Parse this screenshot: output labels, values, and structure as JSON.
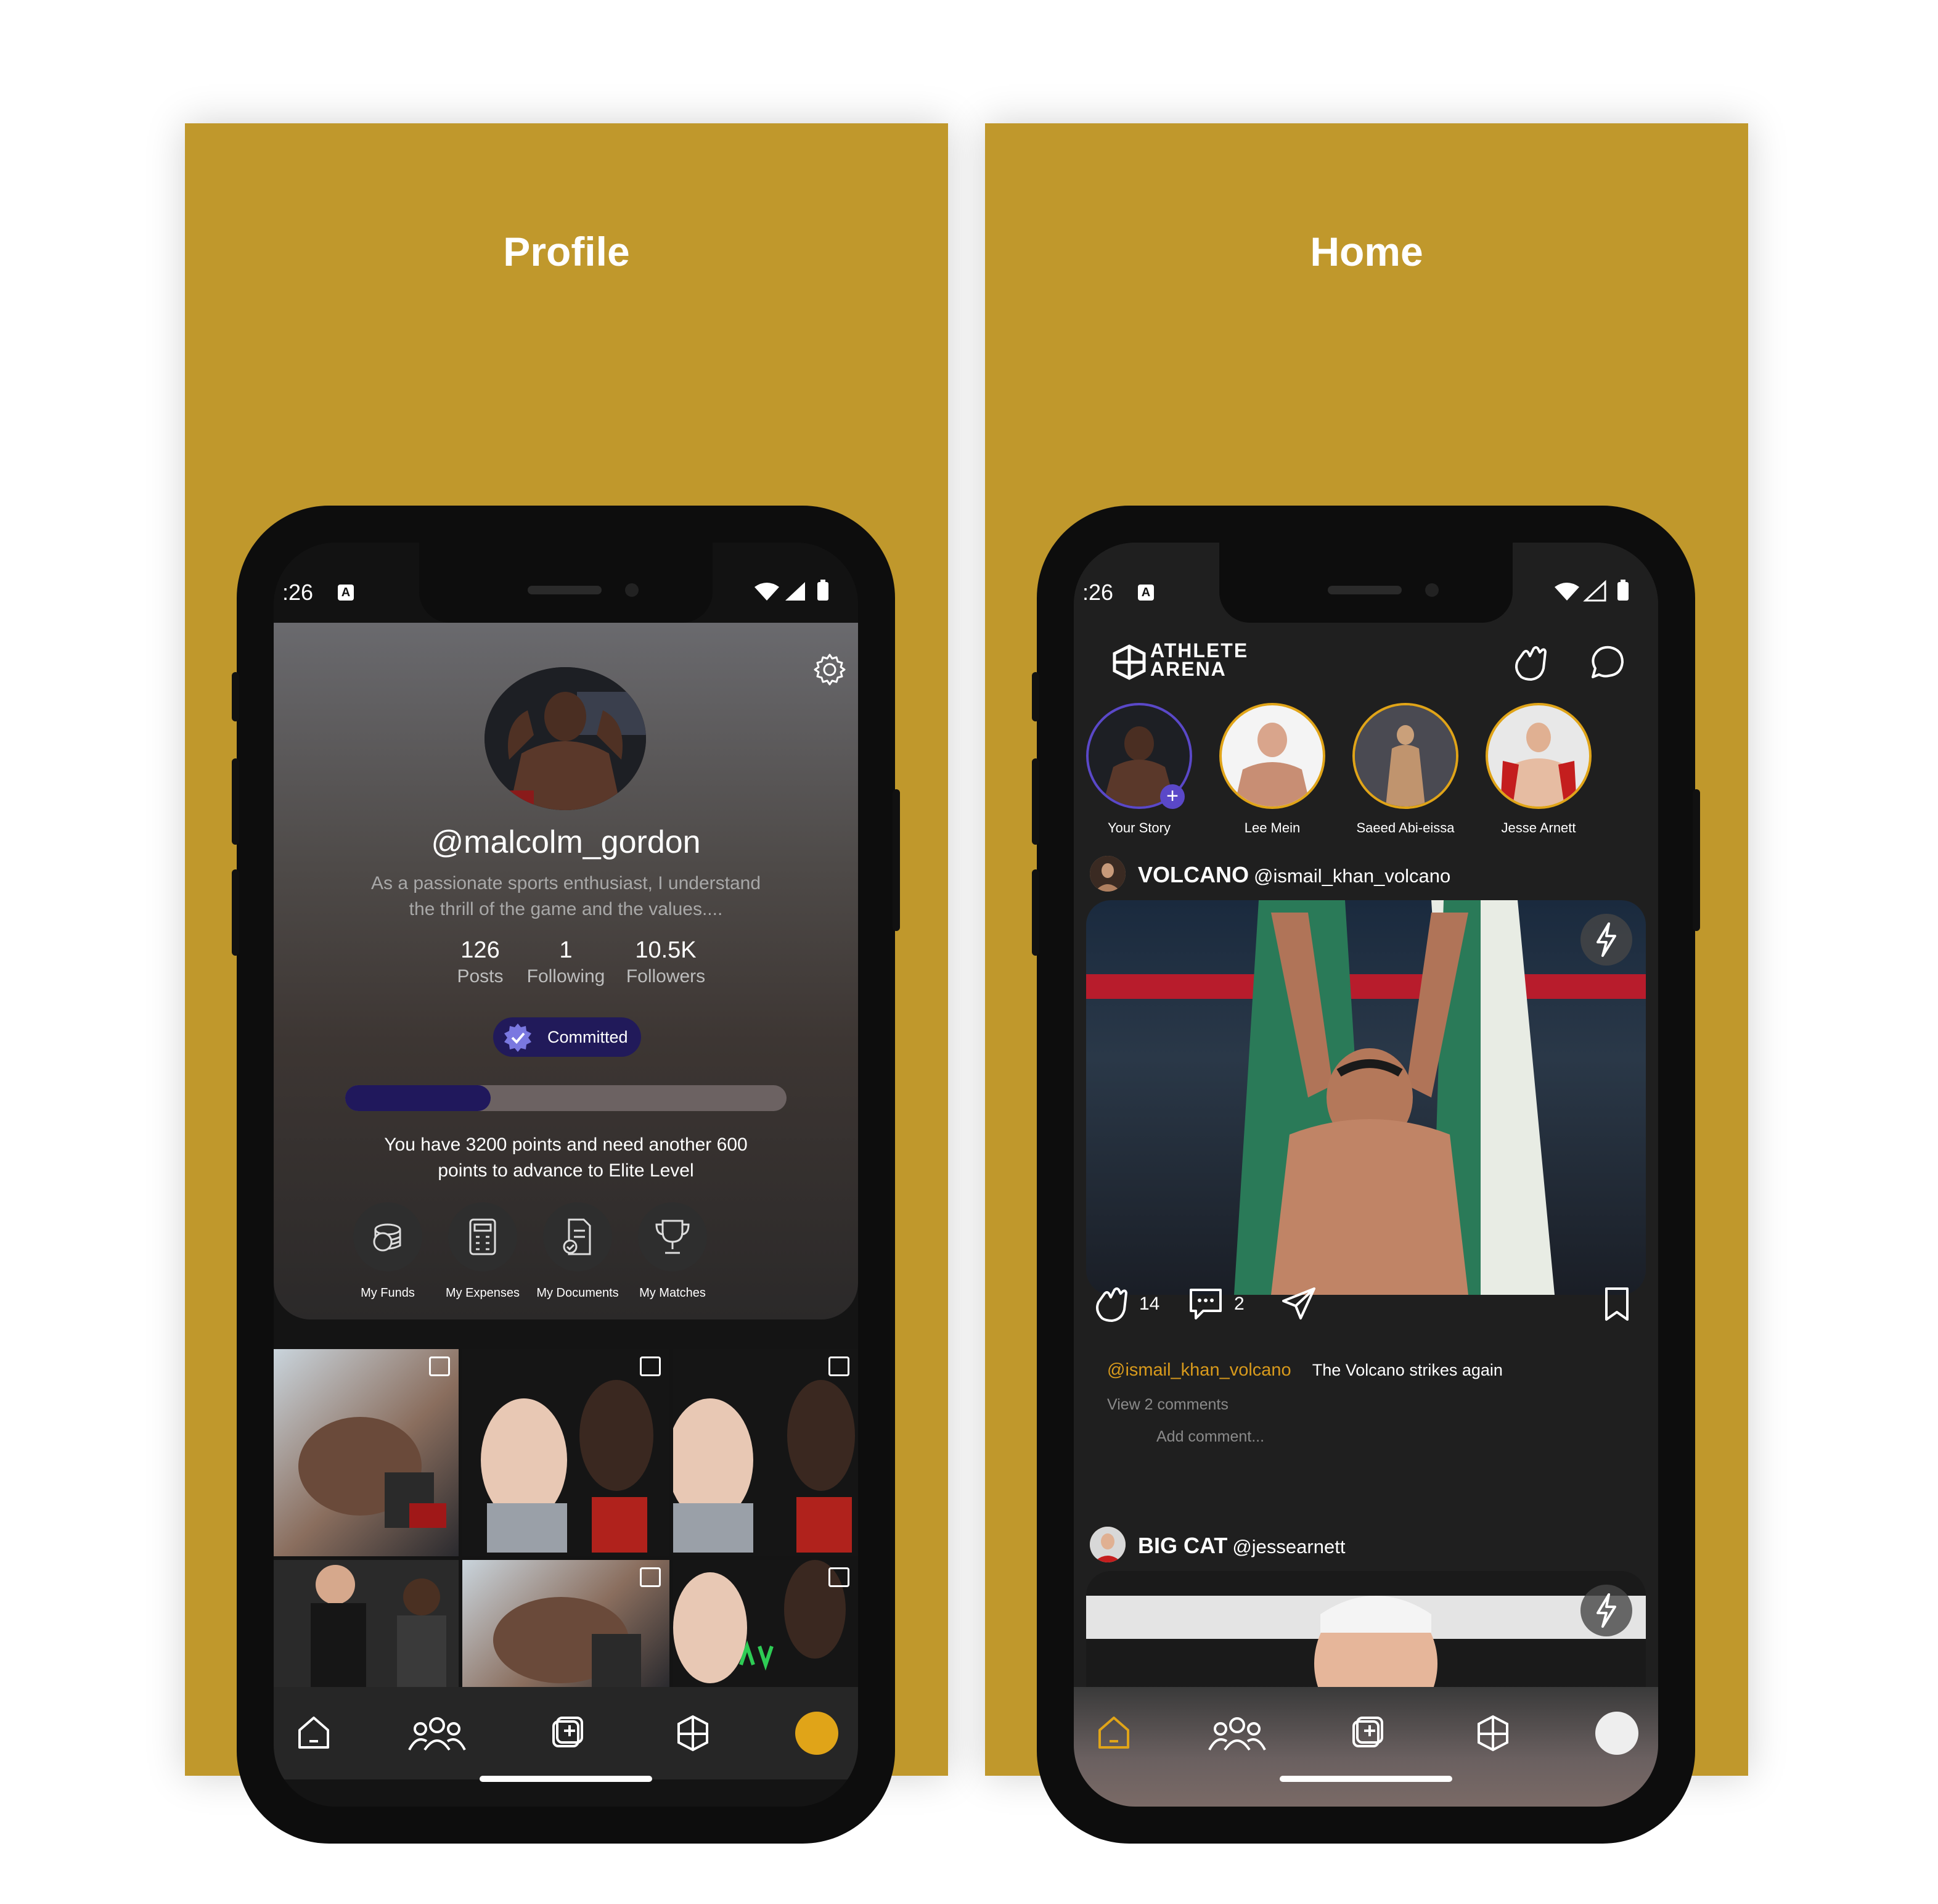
{
  "panels": {
    "left_title": "Profile",
    "right_title": "Home"
  },
  "status": {
    "time": ":26",
    "a_icon": "A"
  },
  "profile": {
    "username": "@malcolm_gordon",
    "bio_line1": "As a passionate sports enthusiast, I understand",
    "bio_line2": "the thrill of the game and the values....",
    "stats": [
      {
        "number": "126",
        "label": "Posts"
      },
      {
        "number": "1",
        "label": "Following"
      },
      {
        "number": "10.5K",
        "label": "Followers"
      }
    ],
    "badge": "Committed",
    "progress_fraction": 0.33,
    "points_line1": "You have 3200 points and need another 600",
    "points_line2": "points to advance to Elite Level",
    "quick_actions": [
      {
        "label": "My Funds",
        "icon": "coins-icon"
      },
      {
        "label": "My Expenses",
        "icon": "calculator-icon"
      },
      {
        "label": "My Documents",
        "icon": "document-icon"
      },
      {
        "label": "My Matches",
        "icon": "trophy-icon"
      }
    ]
  },
  "home": {
    "logo_line1": "ATHLETE",
    "logo_line2": "ARENA",
    "stories": [
      {
        "name": "Your Story"
      },
      {
        "name": "Lee Mein"
      },
      {
        "name": "Saeed Abi-eissa"
      },
      {
        "name": "Jesse Arnett"
      }
    ],
    "post1": {
      "display_name": "VOLCANO",
      "handle": "@ismail_khan_volcano",
      "claps": "14",
      "comments": "2",
      "caption_user": "@ismail_khan_volcano",
      "caption": "The Volcano strikes again",
      "view_comments": "View 2 comments",
      "add_comment": "Add comment..."
    },
    "post2": {
      "display_name": "BIG CAT",
      "handle": "@jessearnett"
    }
  },
  "colors": {
    "panel_bg": "#c0982c",
    "accent": "#e0a418",
    "caption_user": "#d89a1c",
    "badge_bg": "#211a5a",
    "progress_fill": "#20185c"
  }
}
